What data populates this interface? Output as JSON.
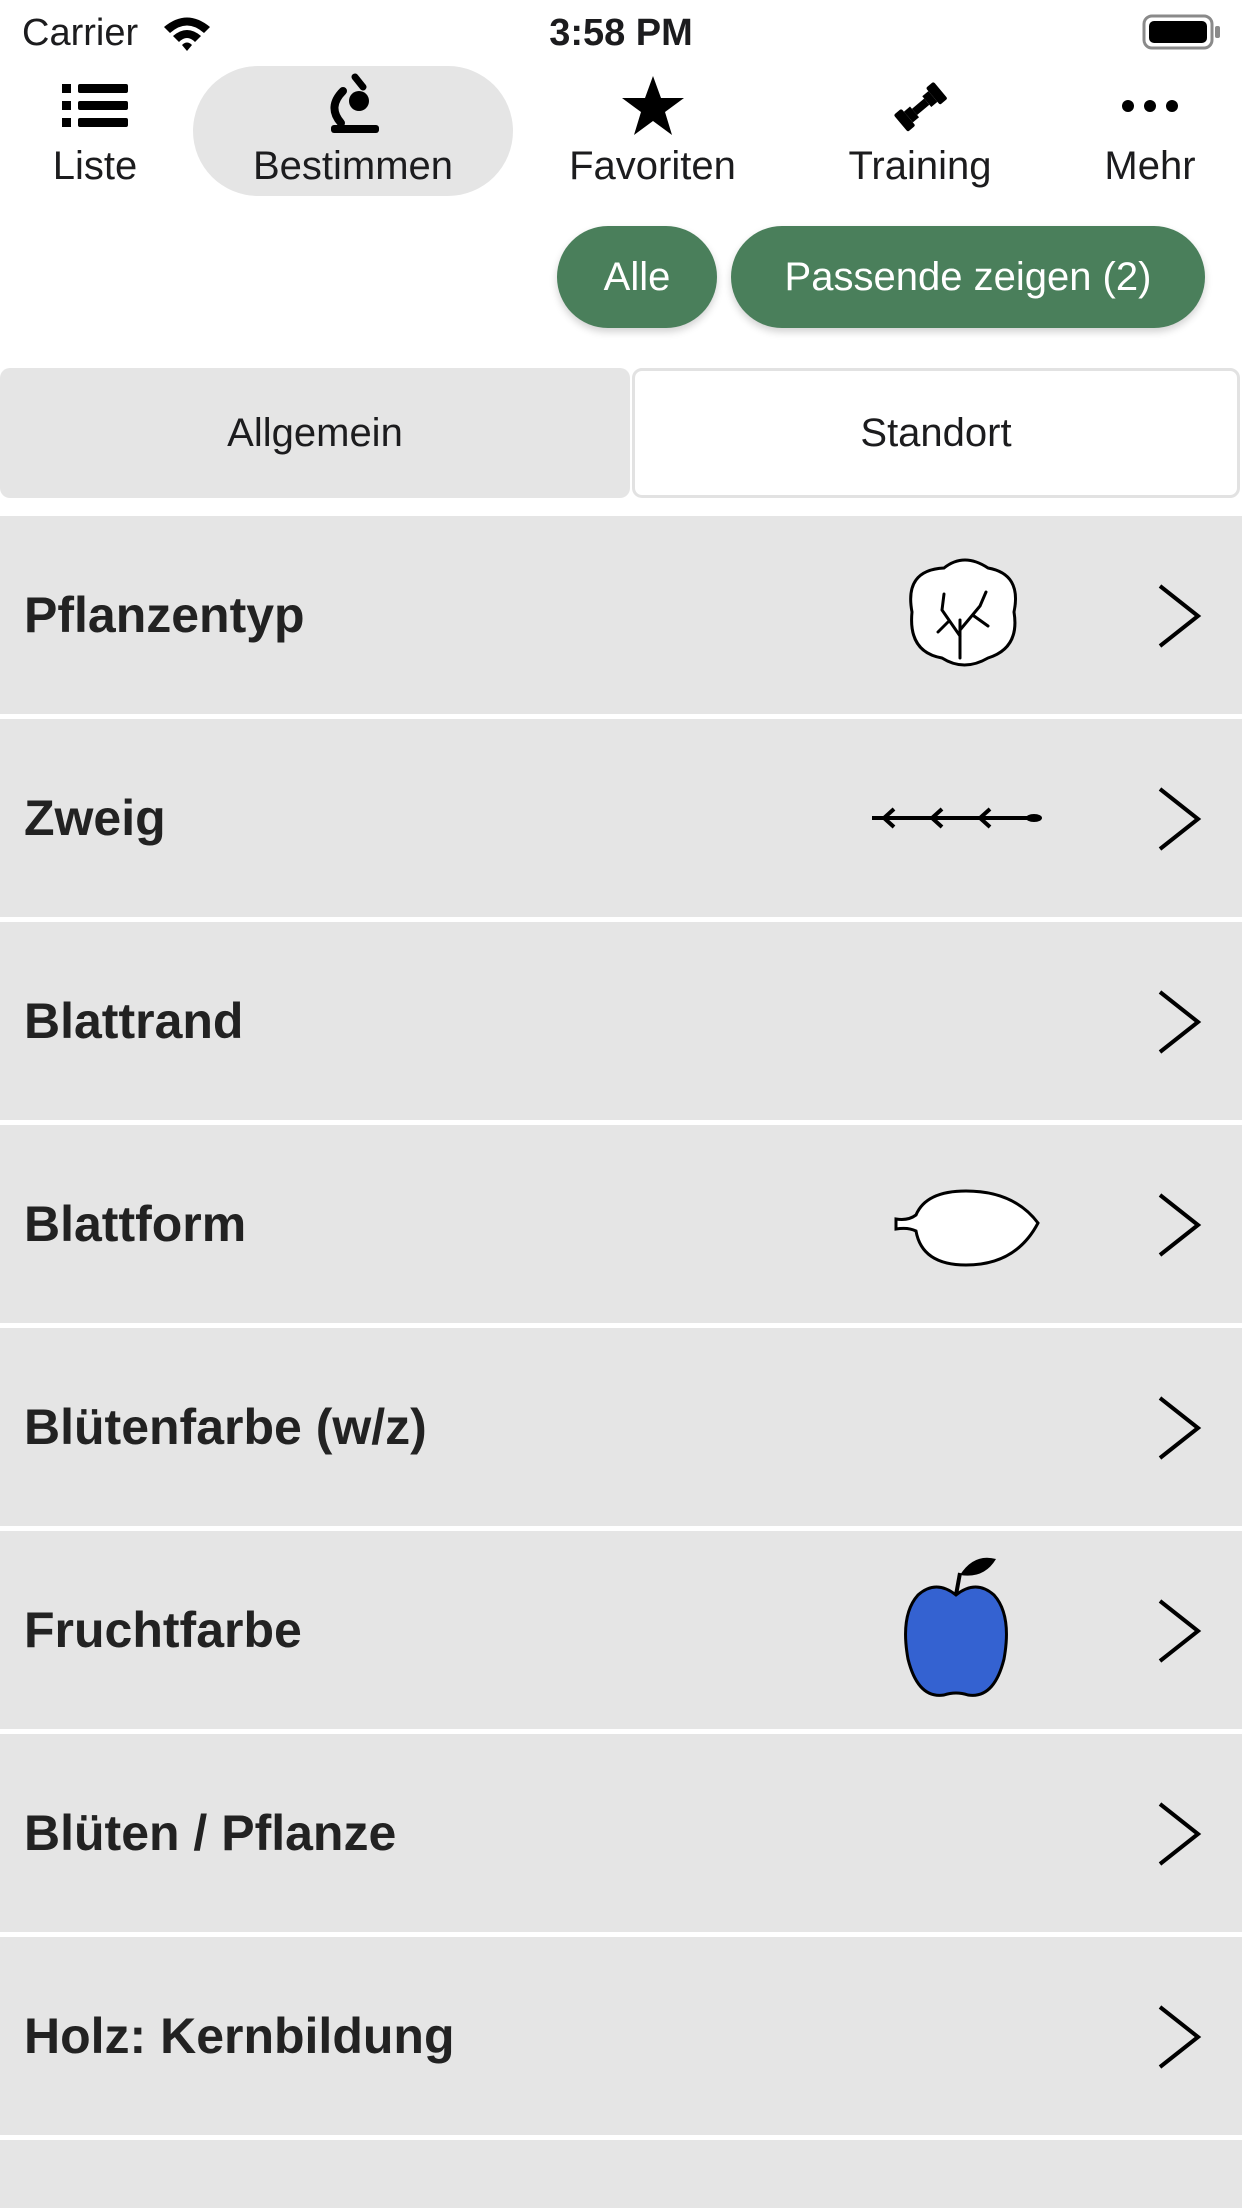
{
  "status_bar": {
    "carrier": "Carrier",
    "time": "3:58 PM"
  },
  "tabs": [
    {
      "label": "Liste",
      "icon": "list-icon",
      "active": false
    },
    {
      "label": "Bestimmen",
      "icon": "microscope-icon",
      "active": true
    },
    {
      "label": "Favoriten",
      "icon": "star-icon",
      "active": false
    },
    {
      "label": "Training",
      "icon": "dumbbell-icon",
      "active": false
    },
    {
      "label": "Mehr",
      "icon": "more-icon",
      "active": false
    }
  ],
  "filters": {
    "all_label": "Alle",
    "match_label": "Passende zeigen (2)"
  },
  "segments": [
    {
      "label": "Allgemein",
      "selected": false
    },
    {
      "label": "Standort",
      "selected": true
    }
  ],
  "rows": [
    {
      "label": "Pflanzentyp",
      "icon": "tree-crown-icon"
    },
    {
      "label": "Zweig",
      "icon": "twig-icon"
    },
    {
      "label": "Blattrand",
      "icon": ""
    },
    {
      "label": "Blattform",
      "icon": "leaf-shape-icon"
    },
    {
      "label": "Blütenfarbe (w/z)",
      "icon": ""
    },
    {
      "label": "Fruchtfarbe",
      "icon": "apple-icon"
    },
    {
      "label": "Blüten / Pflanze",
      "icon": ""
    },
    {
      "label": "Holz: Kernbildung",
      "icon": ""
    },
    {
      "label": "",
      "icon": ""
    }
  ],
  "colors": {
    "accent": "#4a7f5b",
    "row_bg": "#e5e5e5",
    "fruit": "#3462d1"
  }
}
